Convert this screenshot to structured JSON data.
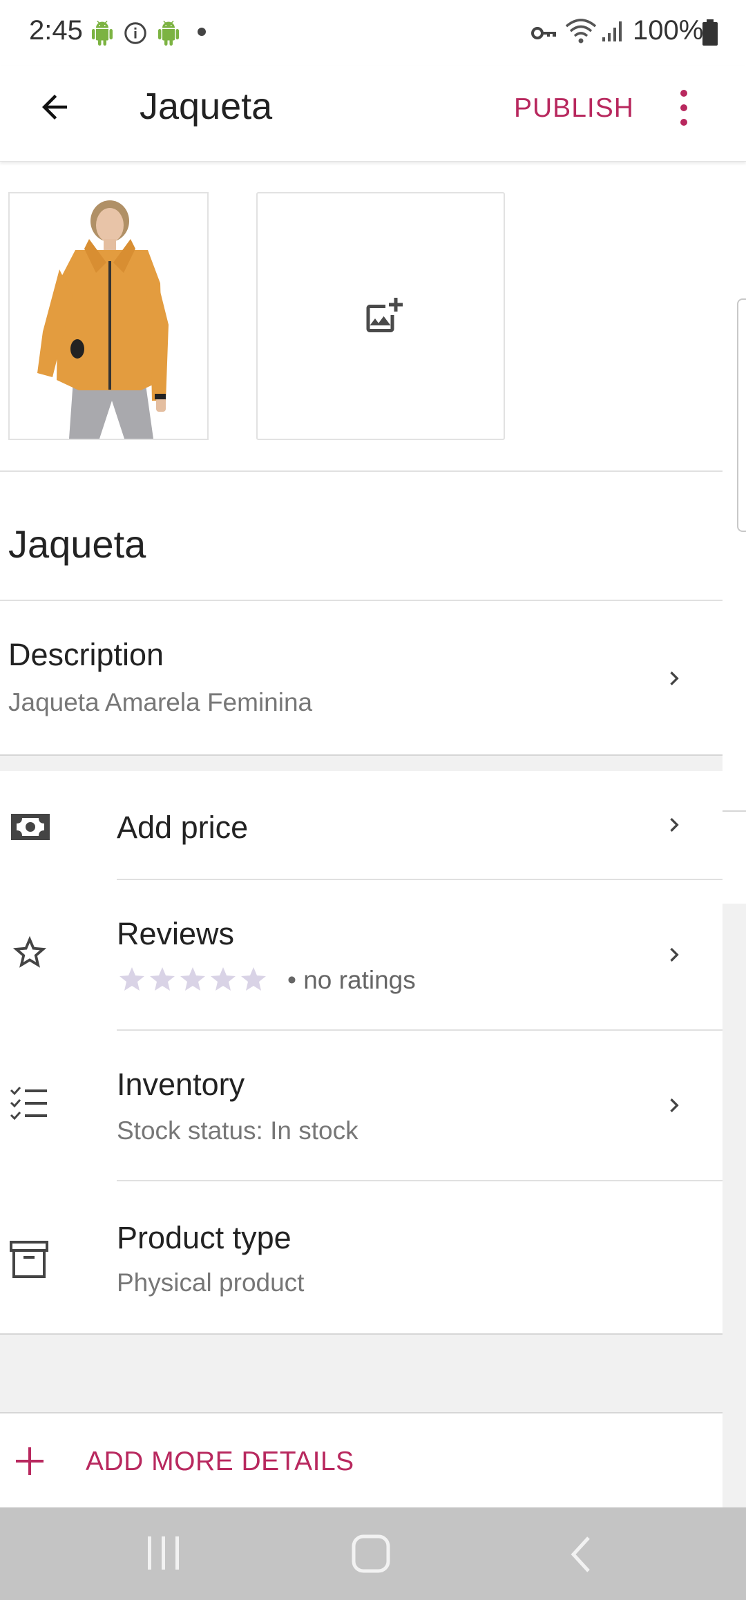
{
  "status_bar": {
    "time": "2:45",
    "battery": "100%",
    "icons": [
      "android-icon",
      "info-icon",
      "android-icon",
      "dot-icon",
      "vpn-key-icon",
      "wifi-icon",
      "signal-icon",
      "battery-icon"
    ]
  },
  "app_bar": {
    "title": "Jaqueta",
    "publish_label": "PUBLISH",
    "accent_color": "#b8285e"
  },
  "images": {
    "product_image_alt": "yellow-jacket-photo",
    "add_image_icon": "add-photo-icon"
  },
  "product": {
    "name": "Jaqueta",
    "description_label": "Description",
    "description_value": "Jaqueta Amarela Feminina"
  },
  "rows": {
    "price": {
      "label": "Add price",
      "icon": "money-icon"
    },
    "reviews": {
      "label": "Reviews",
      "ratings_text": "• no ratings",
      "stars": 5,
      "rating_value": 0,
      "icon": "star-outline-icon"
    },
    "inventory": {
      "label": "Inventory",
      "value": "Stock status: In stock",
      "icon": "checklist-icon"
    },
    "product_type": {
      "label": "Product type",
      "value": "Physical product",
      "icon": "archive-icon"
    }
  },
  "add_more": {
    "label": "ADD MORE DETAILS",
    "icon": "plus-icon"
  },
  "nav_bar": {
    "icons": [
      "recents-icon",
      "home-icon",
      "back-icon"
    ]
  }
}
